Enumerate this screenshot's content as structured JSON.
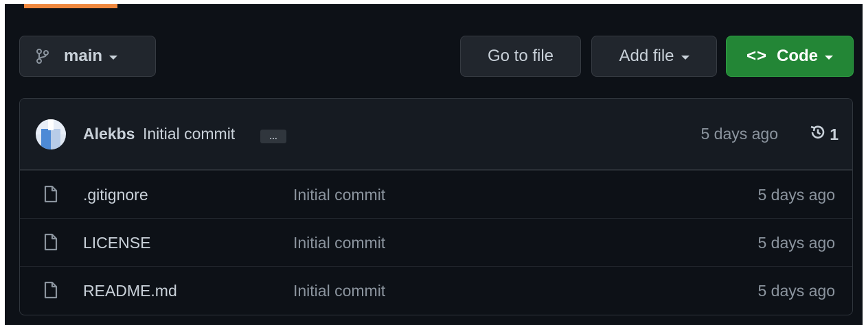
{
  "toolbar": {
    "branch": {
      "label": "main",
      "icon": "git-branch-icon"
    },
    "go_to_file": "Go to file",
    "add_file": "Add file",
    "code": {
      "glyph": "<>",
      "label": "Code"
    }
  },
  "latest_commit": {
    "author": "Alekbs",
    "message": "Initial commit",
    "ellipsis": "…",
    "time": "5 days ago",
    "history_count": "1"
  },
  "files": [
    {
      "name": ".gitignore",
      "commit": "Initial commit",
      "time": "5 days ago",
      "icon": "file-icon"
    },
    {
      "name": "LICENSE",
      "commit": "Initial commit",
      "time": "5 days ago",
      "icon": "file-icon"
    },
    {
      "name": "README.md",
      "commit": "Initial commit",
      "time": "5 days ago",
      "icon": "file-icon"
    }
  ],
  "colors": {
    "background": "#0d1117",
    "header_bg": "#161b22",
    "button_bg": "#21262d",
    "primary_green": "#238636",
    "text": "#c9d1d9",
    "muted_text": "#8b949e",
    "border": "#30363d",
    "accent": "#f0883e"
  }
}
